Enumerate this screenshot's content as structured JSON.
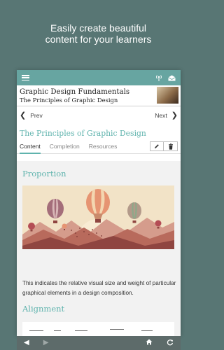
{
  "promo": {
    "line1": "Easily create beautiful",
    "line2": "content for your learners"
  },
  "appbar": {
    "menu_icon": "hamburger-menu-icon",
    "icons": [
      "wireless-signal-icon",
      "envelope-icon"
    ],
    "color": "#67a5a1"
  },
  "course": {
    "title": "Graphic Design Fundamentals",
    "subtitle": "The Principles of Graphic Design"
  },
  "nav": {
    "prev_label": "Prev",
    "next_label": "Next"
  },
  "lesson": {
    "title": "The Principles of Graphic Design",
    "accent": "#5fb3ad"
  },
  "tabs": [
    {
      "label": "Content",
      "active": true
    },
    {
      "label": "Completion",
      "active": false
    },
    {
      "label": "Resources",
      "active": false
    }
  ],
  "tools": [
    "pencil-edit-icon",
    "trash-icon"
  ],
  "sections": {
    "proportion": {
      "heading": "Proportion",
      "description": "This indicates the relative visual size and weight of particular graphical elements in a design composition."
    },
    "alignment": {
      "heading": "Alignment"
    }
  },
  "bottom_bar": {
    "icons": [
      "back-arrow-icon",
      "forward-arrow-icon",
      "home-icon",
      "refresh-icon"
    ]
  }
}
